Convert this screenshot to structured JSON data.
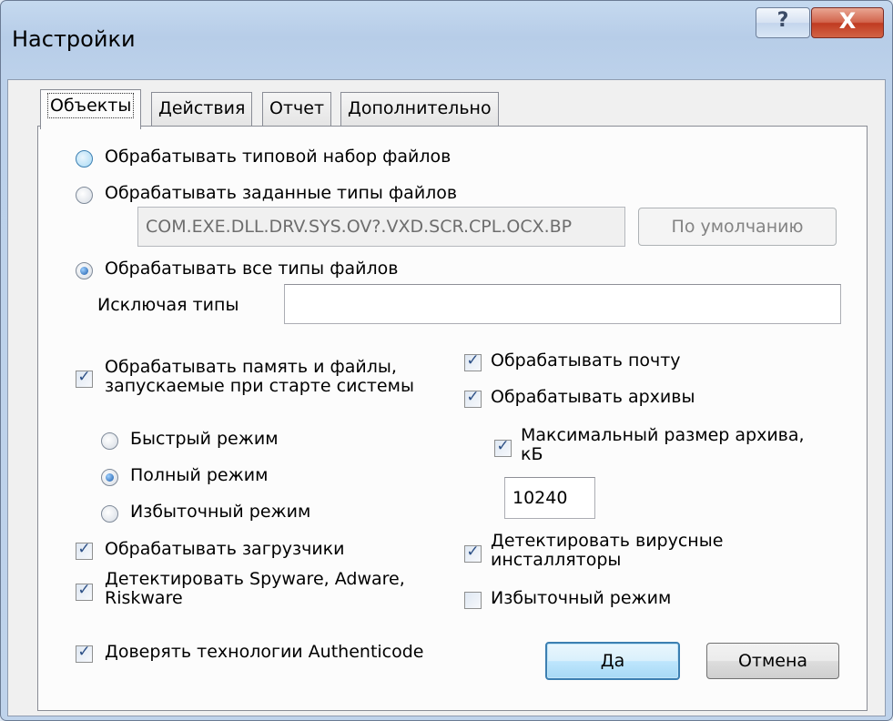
{
  "window": {
    "title": "Настройки",
    "help_label": "?",
    "close_label": "X"
  },
  "tabs": [
    {
      "label": "Объекты",
      "active": true
    },
    {
      "label": "Действия",
      "active": false
    },
    {
      "label": "Отчет",
      "active": false
    },
    {
      "label": "Дополнительно",
      "active": false
    }
  ],
  "file_types": {
    "option_typical": "Обрабатывать типовой набор файлов",
    "option_specified": "Обрабатывать заданные типы файлов",
    "specified_value": "COM.EXE.DLL.DRV.SYS.OV?.VXD.SCR.CPL.OCX.BP",
    "default_button": "По умолчанию",
    "option_all": "Обрабатывать все типы файлов",
    "exclude_label": "Исключая типы",
    "exclude_value": ""
  },
  "left_options": {
    "memory_files": "Обрабатывать память и файлы, запускаемые при старте системы",
    "mode_fast": "Быстрый режим",
    "mode_full": "Полный режим",
    "mode_excess": "Избыточный режим",
    "boot_loaders": "Обрабатывать загрузчики",
    "spyware": "Детектировать Spyware, Adware, Riskware",
    "authenticode": "Доверять технологии Authenticode"
  },
  "right_options": {
    "mail": "Обрабатывать почту",
    "archives": "Обрабатывать архивы",
    "max_archive": "Максимальный размер архива, кБ",
    "max_archive_value": "10240",
    "installers": "Детектировать вирусные инсталляторы",
    "excess_mode": "Избыточный режим"
  },
  "buttons": {
    "ok": "Да",
    "cancel": "Отмена"
  },
  "check_mark": "✓"
}
